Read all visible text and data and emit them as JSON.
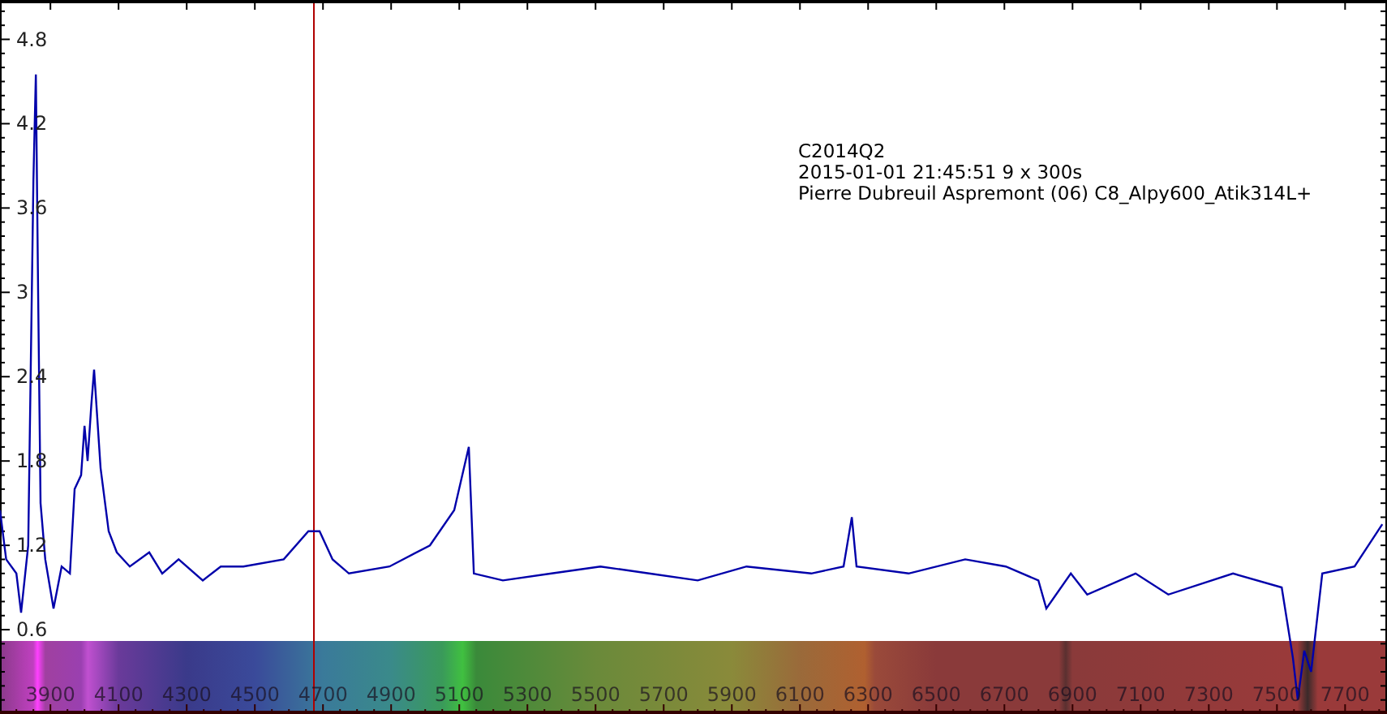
{
  "info": [
    "C2014Q2",
    "2015-01-01 21:45:51   9 x 300s",
    "Pierre Dubreuil Aspremont (06) C8_Alpy600_Atik314L+"
  ],
  "chart_data": {
    "type": "line",
    "xlim": [
      3752,
      7823
    ],
    "ylim": [
      0,
      5.08
    ],
    "xticks": [
      3900,
      4100,
      4300,
      4500,
      4700,
      4900,
      5100,
      5300,
      5500,
      5700,
      5900,
      6100,
      6300,
      6500,
      6700,
      6900,
      7100,
      7300,
      7500,
      7700
    ],
    "yticks": [
      0.6,
      1.2,
      1.8,
      2.4,
      3,
      3.6,
      4.2,
      4.8
    ],
    "x": [
      3752,
      3770,
      3800,
      3814,
      3835,
      3850,
      3857,
      3864,
      3871,
      3885,
      3909,
      3933,
      3957,
      3971,
      3990,
      4000,
      4009,
      4020,
      4028,
      4047,
      4071,
      4095,
      4133,
      4190,
      4228,
      4276,
      4347,
      4400,
      4466,
      4585,
      4657,
      4690,
      4728,
      4776,
      4895,
      5014,
      5085,
      5128,
      5143,
      5228,
      5371,
      5514,
      5657,
      5800,
      5943,
      6133,
      6228,
      6252,
      6266,
      6419,
      6585,
      6704,
      6800,
      6823,
      6895,
      6943,
      7085,
      7181,
      7371,
      7514,
      7547,
      7561,
      7580,
      7600,
      7633,
      7728,
      7809
    ],
    "series": [
      {
        "color": "#0000aa",
        "values": [
          1.45,
          1.1,
          1.0,
          0.72,
          1.2,
          3.8,
          4.55,
          3.0,
          1.5,
          1.1,
          0.75,
          1.05,
          1.0,
          1.6,
          1.7,
          2.05,
          1.8,
          2.2,
          2.45,
          1.75,
          1.3,
          1.15,
          1.05,
          1.15,
          1.0,
          1.1,
          0.95,
          1.05,
          1.05,
          1.1,
          1.3,
          1.3,
          1.1,
          1.0,
          1.05,
          1.2,
          1.45,
          1.9,
          1.0,
          0.95,
          1.0,
          1.05,
          1.0,
          0.95,
          1.05,
          1.0,
          1.05,
          1.4,
          1.05,
          1.0,
          1.1,
          1.05,
          0.95,
          0.75,
          1.0,
          0.85,
          1.0,
          0.85,
          1.0,
          0.9,
          0.4,
          0.1,
          0.45,
          0.3,
          1.0,
          1.05,
          1.35
        ]
      }
    ]
  }
}
